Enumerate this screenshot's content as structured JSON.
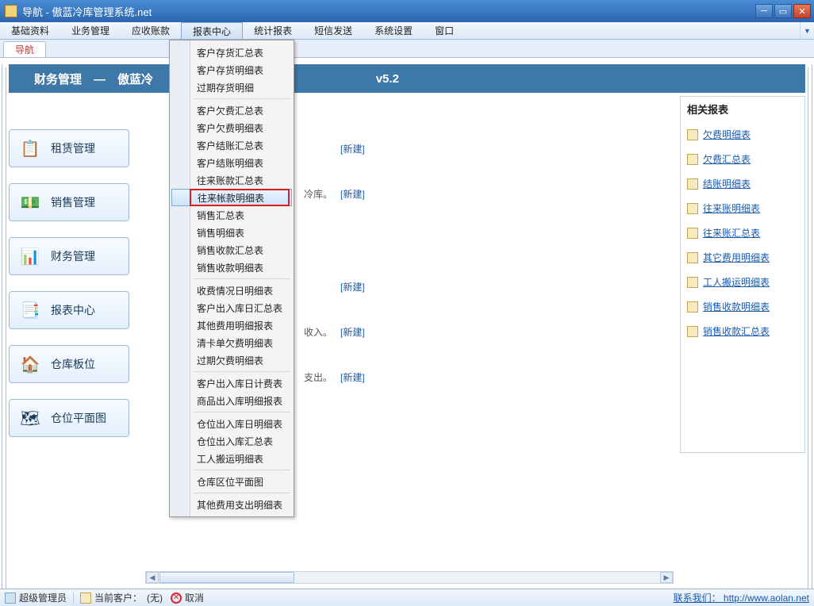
{
  "window": {
    "title": "导航 - 傲蓝冷库管理系统.net"
  },
  "menu": {
    "items": [
      "基础资料",
      "业务管理",
      "应收账款",
      "报表中心",
      "统计报表",
      "短信发送",
      "系统设置",
      "窗口"
    ],
    "active_index": 3
  },
  "tab": {
    "label": "导航"
  },
  "banner": {
    "left": "财务管理　—　傲蓝冷",
    "right": "v5.2"
  },
  "sidebar": [
    {
      "label": "租赁管理",
      "icon": "📋",
      "name": "sidebar-rental"
    },
    {
      "label": "销售管理",
      "icon": "💵",
      "name": "sidebar-sales"
    },
    {
      "label": "财务管理",
      "icon": "📊",
      "name": "sidebar-finance"
    },
    {
      "label": "报表中心",
      "icon": "📑",
      "name": "sidebar-reports"
    },
    {
      "label": "仓库板位",
      "icon": "🏠",
      "name": "sidebar-warehouse"
    },
    {
      "label": "仓位平面图",
      "icon": "🗺",
      "name": "sidebar-floorplan"
    }
  ],
  "center": {
    "new": "[新建]",
    "r1_tail": "冷库。",
    "r3_tail": "收入。",
    "r4_tail": "支出。"
  },
  "dropdown": {
    "g1": [
      "客户存货汇总表",
      "客户存货明细表",
      "过期存货明细"
    ],
    "g2": [
      "客户欠费汇总表",
      "客户欠费明细表",
      "客户结账汇总表",
      "客户结账明细表",
      "往来账款汇总表",
      "往来帐款明细表",
      "销售汇总表",
      "销售明细表",
      "销售收款汇总表",
      "销售收款明细表"
    ],
    "g3": [
      "收费情况日明细表",
      "客户出入库日汇总表",
      "其他费用明细报表",
      "清卡单欠费明细表",
      "过期欠费明细表"
    ],
    "g4": [
      "客户出入库日计费表",
      "商品出入库明细报表"
    ],
    "g5": [
      "仓位出入库日明细表",
      "仓位出入库汇总表",
      "工人搬运明细表"
    ],
    "g6": [
      "仓库区位平面图"
    ],
    "g7": [
      "其他费用支出明细表"
    ],
    "highlight_text": "往来帐款明细表"
  },
  "right_panel": {
    "title": "相关报表",
    "items": [
      "欠费明细表",
      "欠费汇总表",
      "结账明细表",
      "往来账明细表",
      "往来账汇总表",
      "其它费用明细表",
      "工人搬运明细表",
      "销售收款明细表",
      "销售收款汇总表"
    ]
  },
  "status": {
    "user": "超级管理员",
    "current_client_label": "当前客户：",
    "current_client_value": "(无)",
    "cancel": "取消",
    "contact_label": "联系我们：",
    "contact_url": "http://www.aolan.net"
  }
}
